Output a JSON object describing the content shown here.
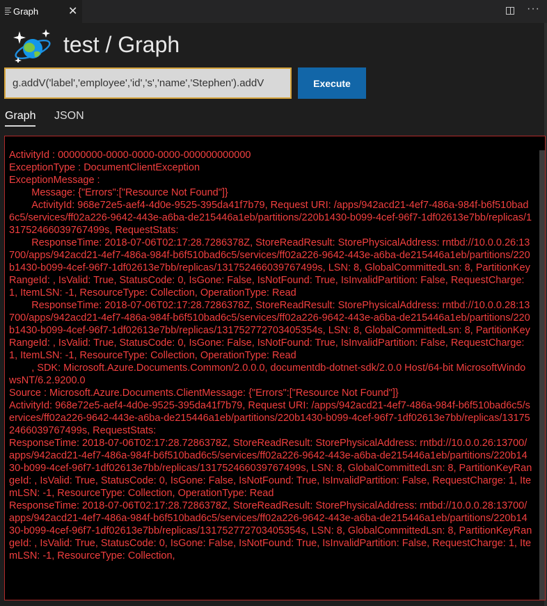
{
  "tab": {
    "label": "Graph",
    "close_glyph": "✕"
  },
  "header": {
    "title": "test / Graph"
  },
  "query": {
    "value": "g.addV('label','employee','id','s','name','Stephen').addV"
  },
  "toolbar": {
    "execute_label": "Execute"
  },
  "view_tabs": [
    "Graph",
    "JSON"
  ],
  "icons": [
    "document-lines-icon",
    "close-icon",
    "split-editor-icon",
    "more-icon",
    "cosmos-db-logo-icon"
  ],
  "colors": {
    "error_text": "#f23f3f",
    "accent": "#1266a8",
    "input_border": "#d4a23a"
  },
  "output_text": "ActivityId : 00000000-0000-0000-0000-000000000000\nExceptionType : DocumentClientException\nExceptionMessage :\n        Message: {\"Errors\":[\"Resource Not Found\"]}\n        ActivityId: 968e72e5-aef4-4d0e-9525-395da41f7b79, Request URI: /apps/942acd21-4ef7-486a-984f-b6f510bad6c5/services/ff02a226-9642-443e-a6ba-de215446a1eb/partitions/220b1430-b099-4cef-96f7-1df02613e7bb/replicas/131752466039767499s, RequestStats:\n        ResponseTime: 2018-07-06T02:17:28.7286378Z, StoreReadResult: StorePhysicalAddress: rntbd://10.0.0.26:13700/apps/942acd21-4ef7-486a-984f-b6f510bad6c5/services/ff02a226-9642-443e-a6ba-de215446a1eb/partitions/220b1430-b099-4cef-96f7-1df02613e7bb/replicas/131752466039767499s, LSN: 8, GlobalCommittedLsn: 8, PartitionKeyRangeId: , IsValid: True, StatusCode: 0, IsGone: False, IsNotFound: True, IsInvalidPartition: False, RequestCharge: 1, ItemLSN: -1, ResourceType: Collection, OperationType: Read\n        ResponseTime: 2018-07-06T02:17:28.7286378Z, StoreReadResult: StorePhysicalAddress: rntbd://10.0.0.28:13700/apps/942acd21-4ef7-486a-984f-b6f510bad6c5/services/ff02a226-9642-443e-a6ba-de215446a1eb/partitions/220b1430-b099-4cef-96f7-1df02613e7bb/replicas/131752772703405354s, LSN: 8, GlobalCommittedLsn: 8, PartitionKeyRangeId: , IsValid: True, StatusCode: 0, IsGone: False, IsNotFound: True, IsInvalidPartition: False, RequestCharge: 1, ItemLSN: -1, ResourceType: Collection, OperationType: Read\n        , SDK: Microsoft.Azure.Documents.Common/2.0.0.0, documentdb-dotnet-sdk/2.0.0 Host/64-bit MicrosoftWindowsNT/6.2.9200.0\nSource : Microsoft.Azure.Documents.ClientMessage: {\"Errors\":[\"Resource Not Found\"]}\nActivityId: 968e72e5-aef4-4d0e-9525-395da41f7b79, Request URI: /apps/942acd21-4ef7-486a-984f-b6f510bad6c5/services/ff02a226-9642-443e-a6ba-de215446a1eb/partitions/220b1430-b099-4cef-96f7-1df02613e7bb/replicas/131752466039767499s, RequestStats:\nResponseTime: 2018-07-06T02:17:28.7286378Z, StoreReadResult: StorePhysicalAddress: rntbd://10.0.0.26:13700/apps/942acd21-4ef7-486a-984f-b6f510bad6c5/services/ff02a226-9642-443e-a6ba-de215446a1eb/partitions/220b1430-b099-4cef-96f7-1df02613e7bb/replicas/131752466039767499s, LSN: 8, GlobalCommittedLsn: 8, PartitionKeyRangeId: , IsValid: True, StatusCode: 0, IsGone: False, IsNotFound: True, IsInvalidPartition: False, RequestCharge: 1, ItemLSN: -1, ResourceType: Collection, OperationType: Read\nResponseTime: 2018-07-06T02:17:28.7286378Z, StoreReadResult: StorePhysicalAddress: rntbd://10.0.0.28:13700/apps/942acd21-4ef7-486a-984f-b6f510bad6c5/services/ff02a226-9642-443e-a6ba-de215446a1eb/partitions/220b1430-b099-4cef-96f7-1df02613e7bb/replicas/131752772703405354s, LSN: 8, GlobalCommittedLsn: 8, PartitionKeyRangeId: , IsValid: True, StatusCode: 0, IsGone: False, IsNotFound: True, IsInvalidPartition: False, RequestCharge: 1, ItemLSN: -1, ResourceType: Collection,"
}
